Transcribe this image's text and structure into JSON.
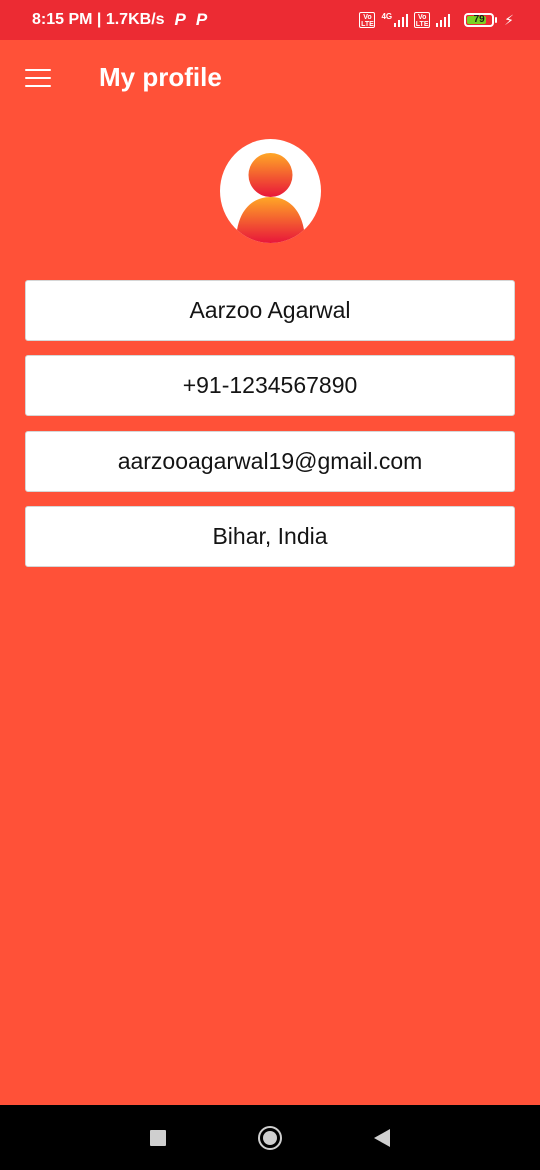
{
  "status_bar": {
    "time_speed": "8:15 PM | 1.7KB/s",
    "notification_icons": [
      "P",
      "P"
    ],
    "volte_label": "Vo LTE",
    "network_type": "4G",
    "battery_level": "79",
    "battery_fraction": 0.79,
    "charging_icon": "lightning-bolt-icon",
    "signal_icon": "signal-bars-icon",
    "background_color": "#ec2b33"
  },
  "toolbar": {
    "menu_icon": "hamburger-menu-icon",
    "title": "My profile"
  },
  "profile": {
    "avatar_icon": "user-avatar-icon",
    "name": "Aarzoo Agarwal",
    "phone": "+91-1234567890",
    "email": "aarzooagarwal19@gmail.com",
    "location": "Bihar, India"
  },
  "nav_bar": {
    "recents_icon": "square-recents-icon",
    "home_icon": "circle-home-icon",
    "back_icon": "triangle-back-icon"
  },
  "colors": {
    "background": "#ff5138",
    "avatar_gradient_top": "#ffa726",
    "avatar_gradient_bottom": "#e8163a"
  }
}
